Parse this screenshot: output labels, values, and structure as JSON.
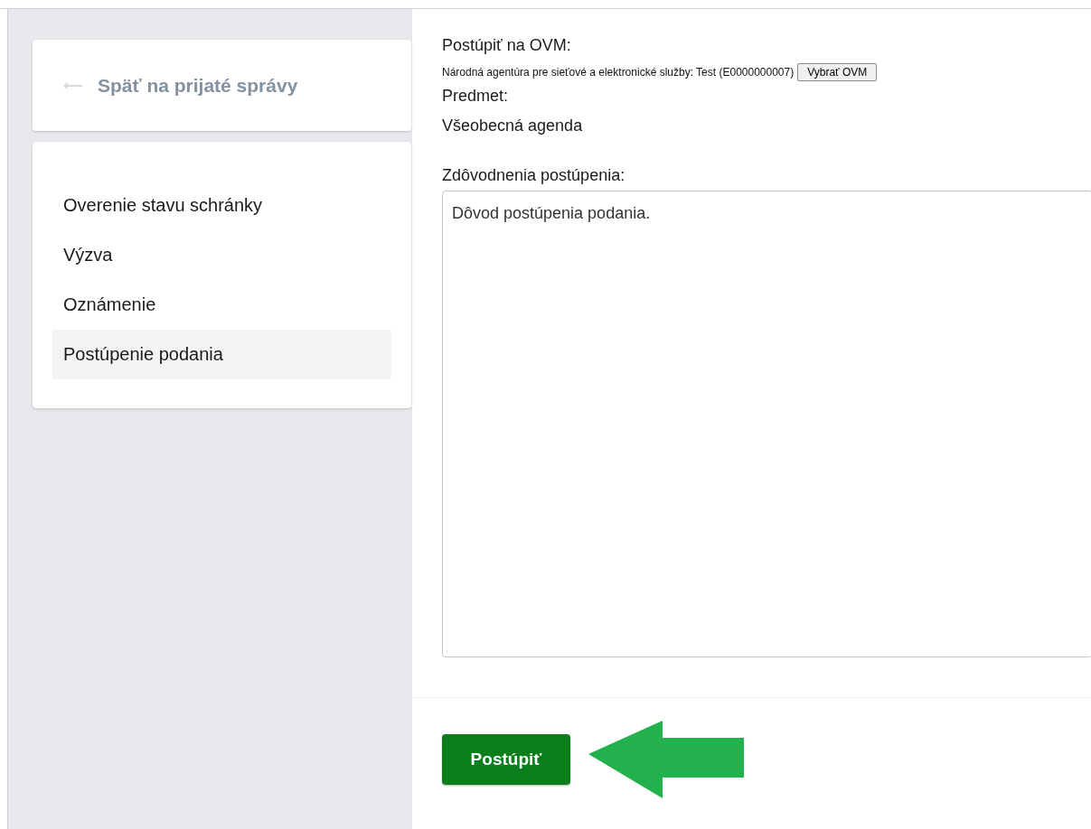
{
  "back_link": {
    "label": "Späť na prijaté správy"
  },
  "menu": [
    {
      "label": "Overenie stavu schránky",
      "selected": false
    },
    {
      "label": "Výzva",
      "selected": false
    },
    {
      "label": "Oznámenie",
      "selected": false
    },
    {
      "label": "Postúpenie podania",
      "selected": true
    }
  ],
  "form": {
    "ovm_label": "Postúpiť na OVM:",
    "ovm_value": "Národná agentúra pre sieťové a elektronické služby: Test (E0000000007)",
    "ovm_button": "Vybrať OVM",
    "subject_label": "Predmet:",
    "subject_value": "Všeobecná agenda",
    "reason_label": "Zdôvodnenia postúpenia:",
    "reason_value": "Dôvod postúpenia podania."
  },
  "submit_button": "Postúpiť"
}
